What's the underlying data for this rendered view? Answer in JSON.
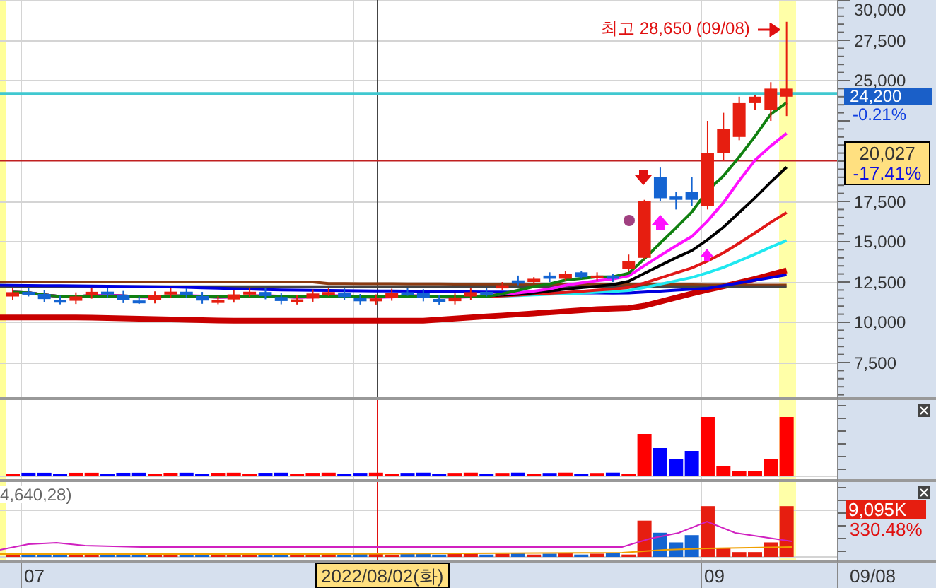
{
  "price_pane": {
    "annotation": "최고 28,650 (09/08)",
    "axis_labels": [
      "30,000",
      "27,500",
      "25,000",
      "17,500",
      "15,000",
      "12,500",
      "10,000",
      "7,500"
    ],
    "current_price": {
      "value": "24,200",
      "change": "-0.21%"
    },
    "cursor_price": {
      "value": "20,027",
      "change": "-17.41%"
    }
  },
  "indicator_pane": {
    "legend": "4,640,28)",
    "current_value": "9,095K",
    "ratio": "330.48%"
  },
  "date_axis": {
    "labels": [
      "07",
      "09"
    ],
    "cursor_date": "2022/08/02(화)",
    "last_date": "09/08"
  }
}
